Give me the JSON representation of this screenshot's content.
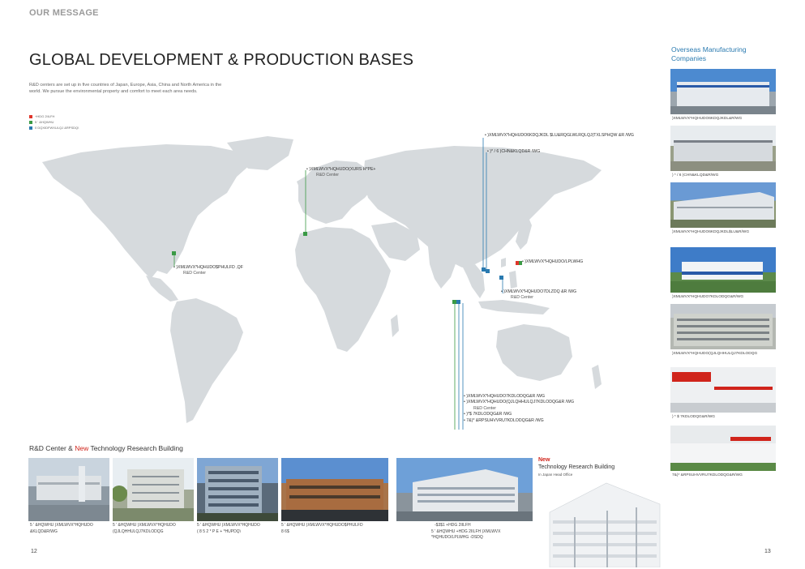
{
  "header": {
    "section_label": "OUR MESSAGE",
    "title": "GLOBAL DEVELOPMENT  & PRODUCTION BASES",
    "intro_line1": "R&D centers are set up in five countries of Japan, Europe, Asia, China and North America in the",
    "intro_line2": "world.  We pursue the environmental property and comfort to meet each area needs."
  },
  "legend": [
    {
      "label": "+HDG 2IILFH",
      "color": "#e0352b"
    },
    {
      "label": "5  ' &HQWHU",
      "color": "#3a9a45"
    },
    {
      "label": "0 DQXIDFWXULQJ &RPSDQ\\",
      "color": "#2a7ab0"
    }
  ],
  "map": {
    "callouts": {
      "europe_name": "• )XMLWVX*HQHUDO(XURS H*PE+",
      "europe_rd": "R&D Center",
      "us_name": "• )XMLWVX*HQHUDO$PHULFD ,QF",
      "us_rd": "R&D Center",
      "china1": "• )XMLWVX*HQHUDO6KDQJKDL $LU&RQGLWLRQLQJ(TXLSPHQW &R /WG",
      "china2": "• )* / 6 )CHN&KLQD&R /WG",
      "japan_name": "• )XMLWVX*HQHUDO/LPLWHG",
      "taiwan_name": "• )XMLWVX*HQHUDO7DLZDQ &R /WG",
      "taiwan_rd": "R&D Center",
      "thai1": "• )XMLWVX*HQHUDO7KDLODQG&R /WG",
      "thai2": "• )XMLWVX*HQHUDO(QJLQHHULQJ7KDLODQG&R /WG",
      "thai_rd": "R&D Center",
      "thai3": "• )*$ 7KDLODQG&R /WG",
      "thai4": "• 7&)* &RPSUHVVRU7KDLODQG&R /WG"
    }
  },
  "rd_section": {
    "title_prefix": "R&D  Center & ",
    "title_new": "New",
    "title_suffix": " Technology  Research  Building",
    "captions": [
      {
        "line1": "5   ' &HQWHU  )XMLWVX*HQHUDO",
        "line2": "&KLQD&R/WG"
      },
      {
        "line1": "5   ' &HQWHU  )XMLWVX*HQHUDO",
        "line2": "(QJLQHHULQJ7KDLODQG"
      },
      {
        "line1": "5   ' &HQWHU  )XMLWVX*HQHUDO",
        "line2": "( 8 5 2 * P E + *HUPDQ\\"
      },
      {
        "line1": "5   ' &HQWHU  )XMLWVX*HQHUDO$PHULFD",
        "line2": "8 6$"
      },
      {
        "line1": "-$3$1 +HDG 2IILFH",
        "line2": "5   ' &HQWHU   +HDG 2IILFH  )XMLWVX",
        "line3": "*HQHUDO/LPLWHG -DSDQ"
      }
    ],
    "new_tag": "New",
    "new_name": "Technology Research Building",
    "new_sub": "In Japan Head Office"
  },
  "sidebar": {
    "title_line1": "Overseas Manufacturing",
    "title_line2": "Companies",
    "captions": [
      ")XMLWVX*HQHUDO6KDQJKDL&R/WG",
      ") * / 6 )CHN&KLQD&R/WG",
      ")XMLWVX*HQHUDO6KDQJKDL$LU&R/WG",
      ")XMLWVX*HQHUDO7KDLODQG&R/WG",
      ")XMLWVX*HQHUDO(QJLQHHULQJ7KDLODQG",
      ") * $ 7KDLODQG&R/WG",
      "7&)* &RPSUHVVRU7KDLODQG&R/WG"
    ]
  },
  "page_numbers": {
    "left": "12",
    "right": "13"
  },
  "colors": {
    "red": "#e0352b",
    "green": "#3a9a45",
    "blue": "#2a7ab0",
    "map": "#d6dadd"
  }
}
